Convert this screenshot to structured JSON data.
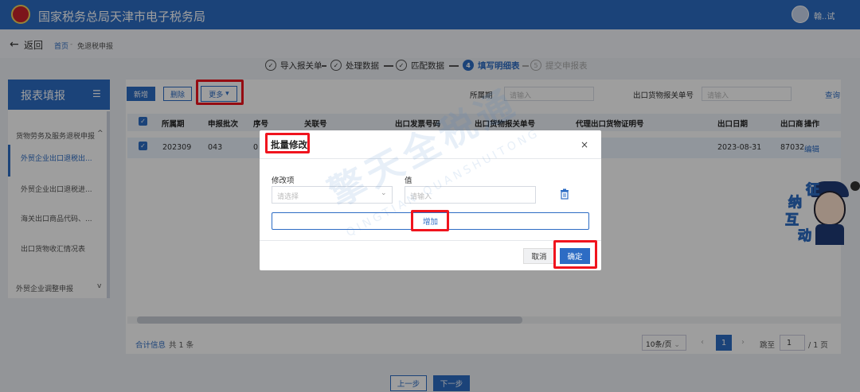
{
  "header": {
    "site_title": "国家税务总局天津市电子税务局",
    "user_name": "翰..试"
  },
  "breadcrumb": {
    "back_label": "返回",
    "home": "首页",
    "sep": "-",
    "current": "免退税申报"
  },
  "steps": [
    {
      "num": "1",
      "label": "导入报关单",
      "state": "done"
    },
    {
      "num": "2",
      "label": "处理数据",
      "state": "done"
    },
    {
      "num": "3",
      "label": "匹配数据",
      "state": "done"
    },
    {
      "num": "4",
      "label": "填写明细表",
      "state": "active"
    },
    {
      "num": "5",
      "label": "提交申报表",
      "state": "todo"
    }
  ],
  "sidebar": {
    "title": "报表填报",
    "groups": [
      {
        "label": "货物劳务及服务退税申报"
      },
      {
        "label": "外贸企业调整申报"
      }
    ],
    "items": [
      {
        "label": "外贸企业出口退税出..."
      },
      {
        "label": "外贸企业出口退税进..."
      },
      {
        "label": "海关出口商品代码、..."
      },
      {
        "label": "出口货物收汇情况表"
      }
    ]
  },
  "toolbar": {
    "add": "新增",
    "delete": "删除",
    "more": "更多"
  },
  "filters": {
    "period_label": "所属期",
    "period_placeholder": "请输入",
    "customs_label": "出口货物报关单号",
    "customs_placeholder": "请输入",
    "query": "查询"
  },
  "table": {
    "headers": [
      "所属期",
      "申报批次",
      "序号",
      "关联号",
      "出口发票号码",
      "出口货物报关单号",
      "代理出口货物证明号",
      "出口日期",
      "出口商",
      "操作"
    ],
    "row": {
      "period": "202309",
      "batch": "043",
      "seq": "0",
      "date": "2023-08-31",
      "exporter": "87032",
      "action": "编辑"
    }
  },
  "footer": {
    "total_label": "合计信息",
    "count": "共 1 条",
    "page_size": "10条/页",
    "page": "1",
    "jump_label": "跳至",
    "jump_value": "1",
    "total_pages": "/ 1 页"
  },
  "bottom": {
    "prev": "上一步",
    "next": "下一步"
  },
  "modal": {
    "title": "批量修改",
    "field_label": "修改项",
    "field_placeholder": "请选择",
    "value_label": "值",
    "value_placeholder": "请输入",
    "add": "增加",
    "cancel": "取消",
    "ok": "确定"
  },
  "watermark": {
    "main": "擎天全税通",
    "sub": "QINGTIAN QUANSHUITONG"
  },
  "mascot": {
    "chars": [
      "征",
      "纳",
      "互",
      "动"
    ]
  },
  "colors": {
    "primary": "#2d6cc4",
    "highlight": "#f0141e"
  },
  "icons": [
    "back-arrow-icon",
    "menu-icon",
    "chevron-down-icon",
    "close-icon",
    "trash-icon",
    "checkbox-icon",
    "avatar-icon",
    "emblem-icon"
  ]
}
